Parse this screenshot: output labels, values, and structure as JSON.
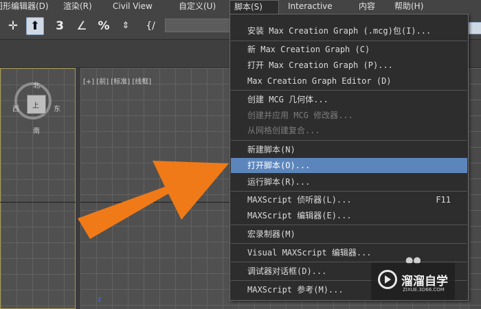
{
  "menubar": {
    "items": [
      {
        "label": "图形编辑器(D)"
      },
      {
        "label": "渲染(R)"
      },
      {
        "label": "Civil View"
      },
      {
        "label": "自定义(U)"
      },
      {
        "label": "脚本(S)"
      },
      {
        "label": "Interactive"
      },
      {
        "label": "内容"
      },
      {
        "label": "帮助(H)"
      }
    ]
  },
  "viewport": {
    "label": "[+] [前] [标准] [线框]",
    "viewcube": {
      "top": "北",
      "left": "西",
      "right": "东",
      "bottom": "南",
      "face": "上"
    },
    "axis_label": "z"
  },
  "script_menu": {
    "items": [
      {
        "label": "安装 Max Creation Graph (.mcg)包(I)...",
        "enabled": true
      },
      {
        "label": "新 Max Creation Graph (C)",
        "enabled": true
      },
      {
        "label": "打开 Max Creation Graph (P)...",
        "enabled": true
      },
      {
        "label": "Max Creation Graph Editor (D)",
        "enabled": true
      },
      {
        "label": "创建 MCG 几何体...",
        "enabled": true
      },
      {
        "label": "创建并应用 MCG 修改器...",
        "enabled": false
      },
      {
        "label": "从网格创建复合...",
        "enabled": false
      },
      {
        "label": "新建脚本(N)",
        "enabled": true
      },
      {
        "label": "打开脚本(O)...",
        "enabled": true,
        "highlighted": true
      },
      {
        "label": "运行脚本(R)...",
        "enabled": true
      },
      {
        "label": "MAXScript 侦听器(L)...",
        "enabled": true,
        "shortcut": "F11"
      },
      {
        "label": "MAXScript 编辑器(E)...",
        "enabled": true
      },
      {
        "label": "宏录制器(M)",
        "enabled": true
      },
      {
        "label": "Visual MAXScript 编辑器...",
        "enabled": true
      },
      {
        "label": "调试器对话框(D)...",
        "enabled": true
      },
      {
        "label": "MAXScript 参考(M)...",
        "enabled": true
      }
    ]
  },
  "watermark": {
    "brand": "溜溜自学",
    "domain": "ZIXUE.3D66.COM"
  },
  "colors": {
    "highlight": "#5c86bb",
    "arrow": "#f07a17",
    "menu_bg": "#2d2d2d",
    "viewport_bg": "#505050"
  }
}
